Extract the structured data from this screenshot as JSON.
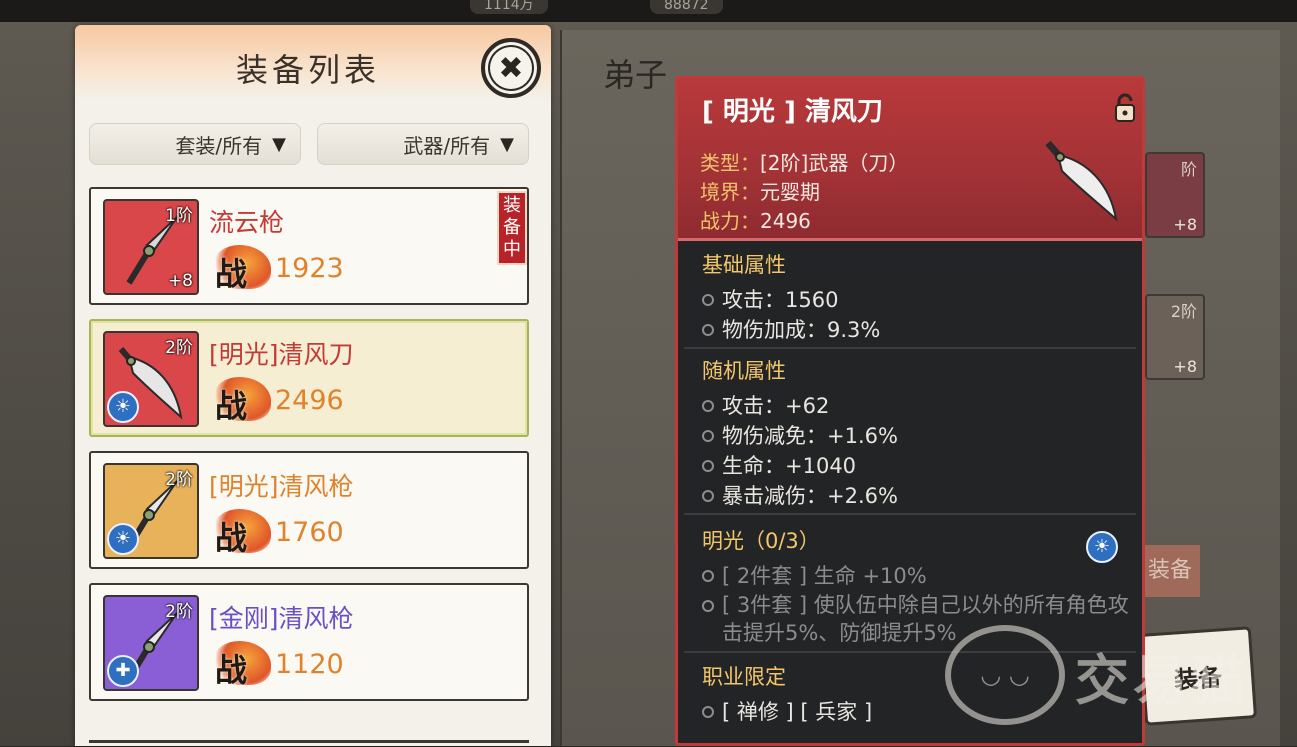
{
  "header_resources": [
    "1114万",
    "88872"
  ],
  "background": {
    "disciple_label": "弟子",
    "side_slots": [
      {
        "tier": "阶",
        "level": "+8"
      },
      {
        "tier": "2阶",
        "level": "+8"
      }
    ],
    "equip_button_label": "装备",
    "faded_equip_label": "装备",
    "watermark_text": "交易猫"
  },
  "equipment_list": {
    "title": "装备列表",
    "filters": {
      "set_filter": "套装/所有",
      "type_filter": "武器/所有"
    },
    "equipped_tag": "装备中",
    "power_glyph": "战",
    "items": [
      {
        "name": "流云枪",
        "tier": "1阶",
        "level": "+8",
        "power": "1923",
        "name_color": "#c33a36",
        "icon_bg": "#d9474a",
        "equipped": true,
        "emblem": ""
      },
      {
        "name": "[明光]清风刀",
        "tier": "2阶",
        "level": "",
        "power": "2496",
        "name_color": "#c33a36",
        "icon_bg": "#d9474a",
        "equipped": false,
        "emblem": "☀"
      },
      {
        "name": "[明光]清风枪",
        "tier": "2阶",
        "level": "",
        "power": "1760",
        "name_color": "#e0822c",
        "icon_bg": "#e8b25a",
        "equipped": false,
        "emblem": "☀"
      },
      {
        "name": "[金刚]清风枪",
        "tier": "2阶",
        "level": "",
        "power": "1120",
        "name_color": "#6a4fc8",
        "icon_bg": "#8a5fd6",
        "equipped": false,
        "emblem": "✚"
      }
    ],
    "selected_index": 1
  },
  "detail": {
    "name": "[ 明光 ] 清风刀",
    "meta": [
      {
        "key": "类型：",
        "value": "[2阶]武器（刀）"
      },
      {
        "key": "境界：",
        "value": "元婴期"
      },
      {
        "key": "战力：",
        "value": "2496"
      }
    ],
    "base_title": "基础属性",
    "base_attrs": [
      "攻击：1560",
      "物伤加成：9.3%"
    ],
    "random_title": "随机属性",
    "random_attrs": [
      "攻击：+62",
      "物伤减免：+1.6%",
      "生命：+1040",
      "暴击减伤：+2.6%"
    ],
    "set_title": "明光（0/3）",
    "set_bonuses": [
      "[ 2件套 ] 生命 +10%",
      "[ 3件套 ] 使队伍中除自己以外的所有角色攻击提升5%、防御提升5%"
    ],
    "class_title": "职业限定",
    "class_values": [
      "[ 禅修 ] [ 兵家 ]"
    ]
  },
  "colors": {
    "detail_border": "#c03a3a",
    "section_title": "#f2c66a",
    "power_value": "#e0822c"
  }
}
